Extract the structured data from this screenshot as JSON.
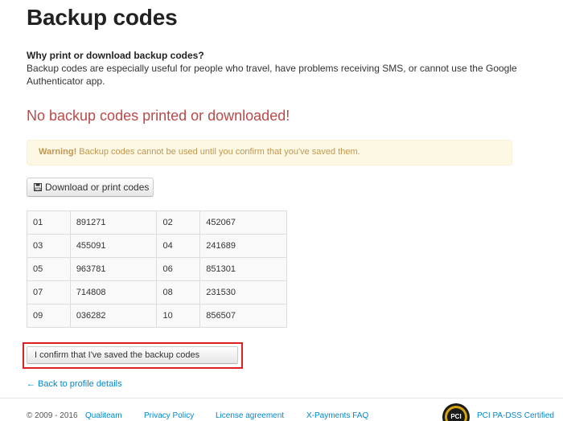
{
  "page": {
    "title": "Backup codes"
  },
  "info": {
    "heading": "Why print or download backup codes?",
    "text": "Backup codes are especially useful for people who travel, have problems receiving SMS, or cannot use the Google Authenticator app."
  },
  "alert": {
    "title": "No backup codes printed or downloaded!"
  },
  "warning": {
    "strong": "Warning!",
    "text": " Backup codes cannot be used until you confirm that you've saved them."
  },
  "actions": {
    "download_label": "Download or print codes",
    "confirm_label": "I confirm that I've saved the backup codes",
    "back_label": "← Back to profile details"
  },
  "codes": [
    {
      "num": "01",
      "code": "891271"
    },
    {
      "num": "02",
      "code": "452067"
    },
    {
      "num": "03",
      "code": "455091"
    },
    {
      "num": "04",
      "code": "241689"
    },
    {
      "num": "05",
      "code": "963781"
    },
    {
      "num": "06",
      "code": "851301"
    },
    {
      "num": "07",
      "code": "714808"
    },
    {
      "num": "08",
      "code": "231530"
    },
    {
      "num": "09",
      "code": "036282"
    },
    {
      "num": "10",
      "code": "856507"
    }
  ],
  "footer": {
    "copyright": "© 2009 - 2016",
    "links": {
      "qualiteam": "Qualiteam",
      "privacy": "Privacy Policy",
      "license": "License agreement",
      "faq": "X-Payments FAQ",
      "pci": "PCI PA-DSS Certified"
    },
    "logo_icon": "pci-badge-icon",
    "logo_text": "PCI"
  },
  "colors": {
    "alert_red": "#b94a48",
    "warning_bg": "#fcf8e3",
    "warning_text": "#c09853",
    "link_blue": "#0088cc",
    "highlight_red": "#e02020"
  }
}
